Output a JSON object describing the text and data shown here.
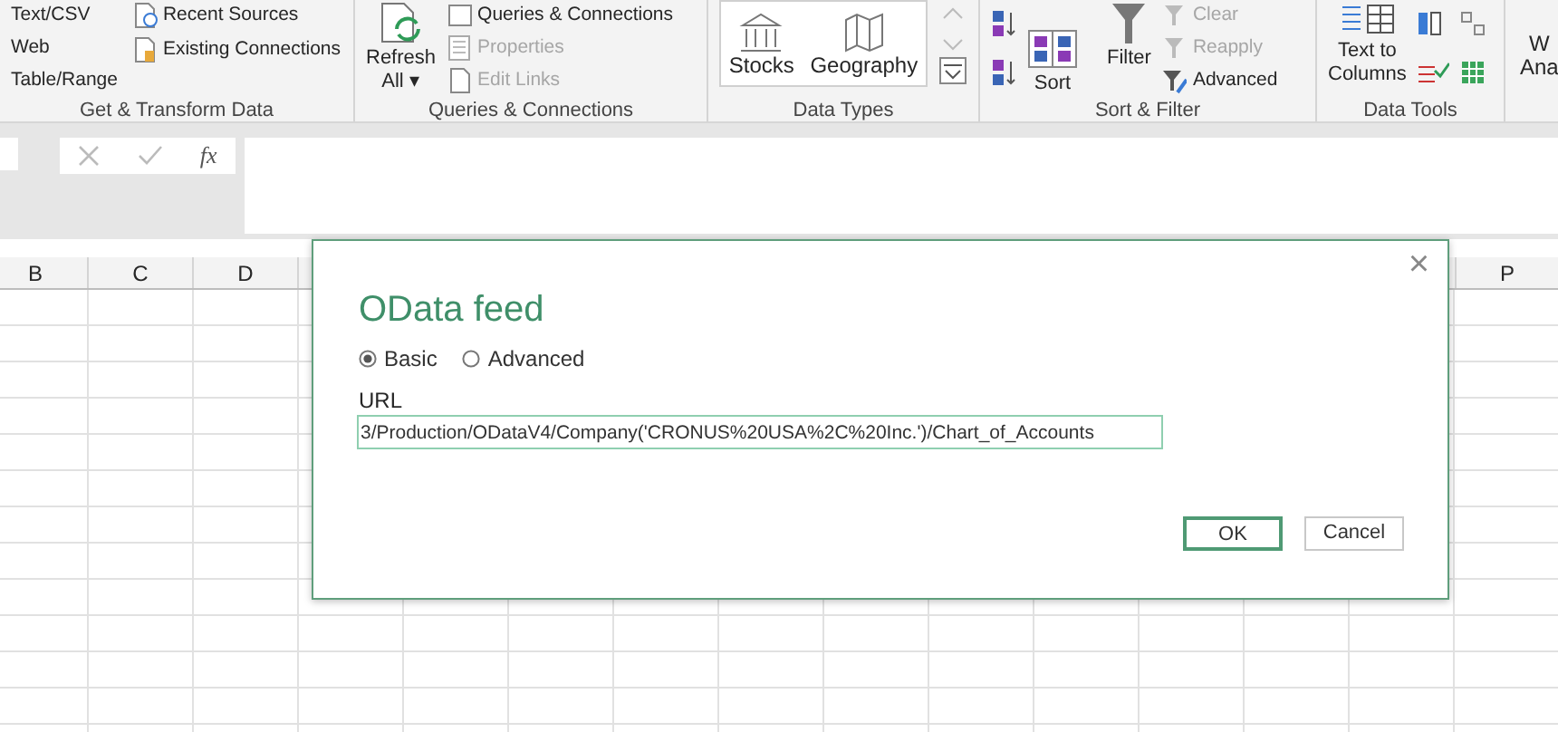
{
  "ribbon": {
    "groups": [
      {
        "label": "Get & Transform Data",
        "left_items": [
          {
            "label": "Text/CSV",
            "disabled": false
          },
          {
            "label": "Web",
            "disabled": false
          },
          {
            "label": "Table/Range",
            "disabled": false
          }
        ],
        "right_items": [
          {
            "label": "Recent Sources",
            "disabled": false
          },
          {
            "label": "Existing Connections",
            "disabled": false
          }
        ]
      },
      {
        "label": "Queries & Connections",
        "big_button": {
          "label": "Refresh",
          "sublabel": "All",
          "dropdown": "▾"
        },
        "items": [
          {
            "label": "Queries & Connections",
            "disabled": false
          },
          {
            "label": "Properties",
            "disabled": true
          },
          {
            "label": "Edit Links",
            "disabled": true
          }
        ]
      },
      {
        "label": "Data Types",
        "gallery": [
          {
            "label": "Stocks"
          },
          {
            "label": "Geography"
          }
        ]
      },
      {
        "label": "Sort & Filter",
        "sort": "Sort",
        "filter": "Filter",
        "items": [
          {
            "label": "Clear",
            "disabled": true
          },
          {
            "label": "Reapply",
            "disabled": true
          },
          {
            "label": "Advanced",
            "disabled": false
          }
        ]
      },
      {
        "label": "Data Tools",
        "big_button": {
          "label": "Text to",
          "sublabel": "Columns"
        }
      }
    ],
    "cut_group": {
      "line1": "W",
      "line2": "Ana"
    }
  },
  "formula_bar": {
    "function_symbol": "fx"
  },
  "sheet": {
    "columns": [
      {
        "label": "B"
      },
      {
        "label": "C"
      },
      {
        "label": "D"
      },
      {
        "label": "P"
      }
    ]
  },
  "dialog": {
    "title": "OData feed",
    "close": "×",
    "modes": [
      {
        "label": "Basic",
        "selected": true
      },
      {
        "label": "Advanced",
        "selected": false
      }
    ],
    "url_label": "URL",
    "url_value": "3/Production/ODataV4/Company('CRONUS%20USA%2C%20Inc.')/Chart_of_Accounts",
    "buttons": [
      {
        "label": "OK",
        "default": true
      },
      {
        "label": "Cancel",
        "default": false
      }
    ]
  }
}
